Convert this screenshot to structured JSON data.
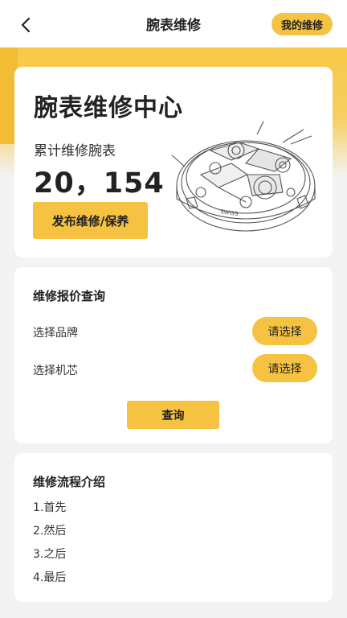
{
  "header": {
    "title": "腕表维修",
    "my_repair_label": "我的维修"
  },
  "hero": {
    "title": "腕表维修中心",
    "subtitle": "累计维修腕表",
    "count": "20，154",
    "publish_label": "发布维修/保养",
    "watch_dial_text": "SWISS"
  },
  "quote": {
    "title": "维修报价查询",
    "rows": [
      {
        "label": "选择品牌",
        "button": "请选择"
      },
      {
        "label": "选择机芯",
        "button": "请选择"
      }
    ],
    "query_label": "查询"
  },
  "process": {
    "title": "维修流程介绍",
    "steps": [
      "1.首先",
      "2.然后",
      "3.之后",
      "4.最后"
    ]
  },
  "colors": {
    "accent": "#f5c242",
    "header_band": "#f7c948",
    "background": "#f3f3f3"
  },
  "icons": {
    "back": "chevron-left-icon",
    "hero_image": "watch-movement-illustration"
  }
}
